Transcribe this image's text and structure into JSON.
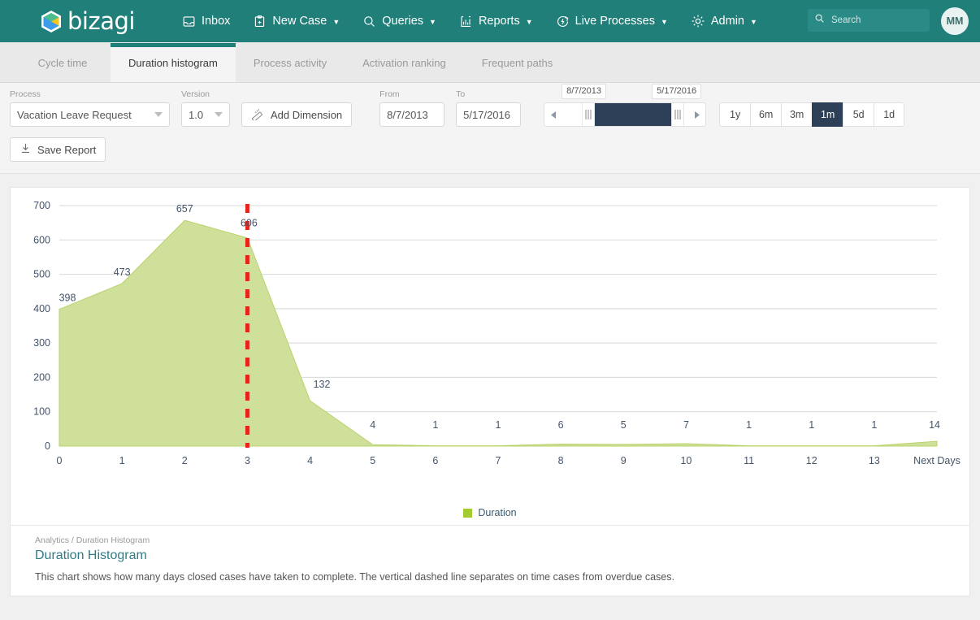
{
  "header": {
    "brand": "bizagi",
    "brand_icon": "bizagi-hex-logo-icon",
    "nav": [
      {
        "label": "Inbox",
        "icon": "inbox-icon",
        "caret": false
      },
      {
        "label": "New Case",
        "icon": "new-case-clipboard-icon",
        "caret": true
      },
      {
        "label": "Queries",
        "icon": "search-magnifier-icon",
        "caret": true
      },
      {
        "label": "Reports",
        "icon": "bar-chart-icon",
        "caret": true
      },
      {
        "label": "Live Processes",
        "icon": "live-processes-icon",
        "caret": true
      },
      {
        "label": "Admin",
        "icon": "gear-icon",
        "caret": true
      }
    ],
    "search": {
      "placeholder": "Search",
      "value": "",
      "icon": "search-icon"
    },
    "avatar_initials": "MM",
    "accent_color": "#217f7a"
  },
  "tabs": [
    {
      "label": "Cycle time",
      "active": false
    },
    {
      "label": "Duration histogram",
      "active": true
    },
    {
      "label": "Process activity",
      "active": false
    },
    {
      "label": "Activation ranking",
      "active": false
    },
    {
      "label": "Frequent paths",
      "active": false
    }
  ],
  "filters": {
    "process_label": "Process",
    "process_value": "Vacation Leave Request",
    "version_label": "Version",
    "version_value": "1.0",
    "add_dimension_label": "Add Dimension",
    "add_dimension_icon": "ruler-icon",
    "from_label": "From",
    "from_value": "8/7/2013",
    "to_label": "To",
    "to_value": "5/17/2016",
    "slider_start_label": "8/7/2013",
    "slider_end_label": "5/17/2016",
    "range_buttons": [
      {
        "label": "1y",
        "active": false
      },
      {
        "label": "6m",
        "active": false
      },
      {
        "label": "3m",
        "active": false
      },
      {
        "label": "1m",
        "active": true
      },
      {
        "label": "5d",
        "active": false
      },
      {
        "label": "1d",
        "active": false
      }
    ],
    "save_report_label": "Save Report",
    "save_report_icon": "download-icon"
  },
  "chart_data": {
    "type": "area",
    "title": "",
    "xlabel": "",
    "ylabel": "",
    "categories": [
      "0",
      "1",
      "2",
      "3",
      "4",
      "5",
      "6",
      "7",
      "8",
      "9",
      "10",
      "11",
      "12",
      "13",
      "Next Days"
    ],
    "values": [
      398,
      473,
      657,
      606,
      132,
      4,
      1,
      1,
      6,
      5,
      7,
      1,
      1,
      1,
      14
    ],
    "point_labels": [
      "398",
      "473",
      "657",
      "606",
      "132",
      "4",
      "1",
      "1",
      "6",
      "5",
      "7",
      "1",
      "1",
      "1",
      "14"
    ],
    "labeled_points": [
      0,
      1,
      2,
      3,
      4,
      5,
      6,
      7,
      8,
      9,
      10,
      11,
      12,
      13,
      14
    ],
    "yticks": [
      0,
      100,
      200,
      300,
      400,
      500,
      600,
      700
    ],
    "ylim": [
      0,
      700
    ],
    "grid": true,
    "legend": [
      {
        "name": "Duration",
        "color": "#a4cc30"
      }
    ],
    "legend_position": "bottom",
    "area_fill_color": "#cfe09a",
    "annotations": [
      {
        "type": "vline",
        "label": "on-time / overdue divider",
        "x_category": "3",
        "style": "dashed",
        "color": "#e8231a"
      }
    ]
  },
  "footer": {
    "breadcrumb": "Analytics / Duration Histogram",
    "title": "Duration Histogram",
    "description": "This chart shows how many days closed cases have taken to complete. The vertical dashed line separates on time cases from overdue cases."
  }
}
